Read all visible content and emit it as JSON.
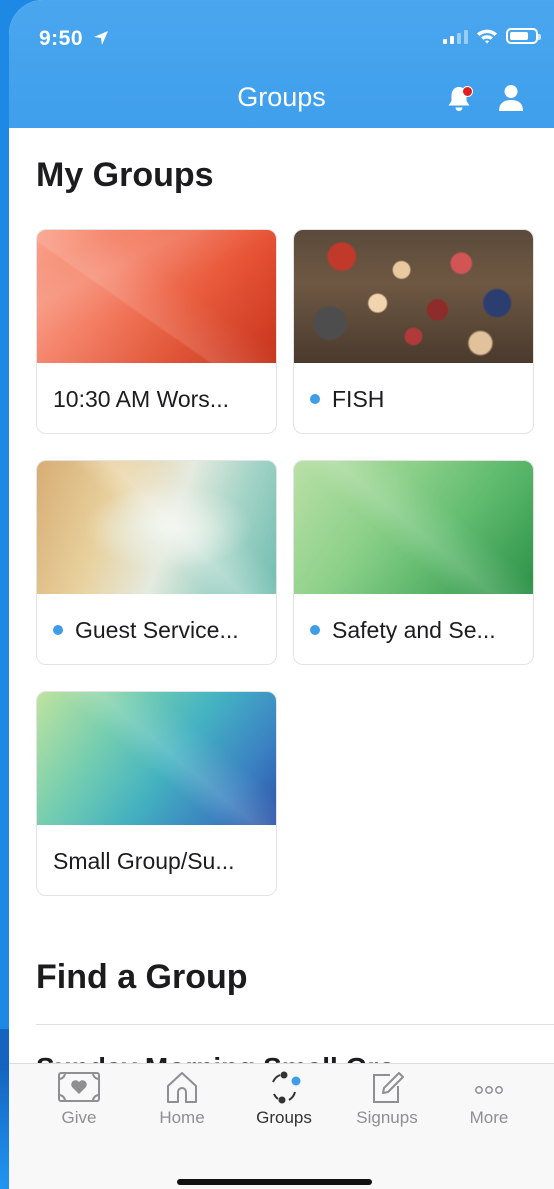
{
  "status_bar": {
    "time": "9:50"
  },
  "header": {
    "title": "Groups"
  },
  "my_groups": {
    "title": "My Groups",
    "groups": [
      {
        "name": "10:30 AM Wors...",
        "unread": false,
        "image": "red polygon pattern"
      },
      {
        "name": "FISH",
        "unread": true,
        "image": "group photo"
      },
      {
        "name": "Guest Service...",
        "unread": true,
        "image": "tan and teal polygon pattern"
      },
      {
        "name": "Safety and Se...",
        "unread": true,
        "image": "green polygon pattern"
      },
      {
        "name": "Small Group/Su...",
        "unread": false,
        "image": "green to blue polygon pattern"
      }
    ]
  },
  "find_group": {
    "title": "Find a Group",
    "first_item": "Sunday Morning Small Gro..."
  },
  "tab_bar": {
    "tabs": [
      {
        "label": "Give",
        "icon": "give-icon",
        "active": false
      },
      {
        "label": "Home",
        "icon": "home-icon",
        "active": false
      },
      {
        "label": "Groups",
        "icon": "groups-icon",
        "active": true
      },
      {
        "label": "Signups",
        "icon": "signups-icon",
        "active": false
      },
      {
        "label": "More",
        "icon": "more-icon",
        "active": false
      }
    ]
  },
  "colors": {
    "header": "#4aa6ee",
    "accent": "#3d9de8",
    "notification_dot": "#e02020"
  }
}
